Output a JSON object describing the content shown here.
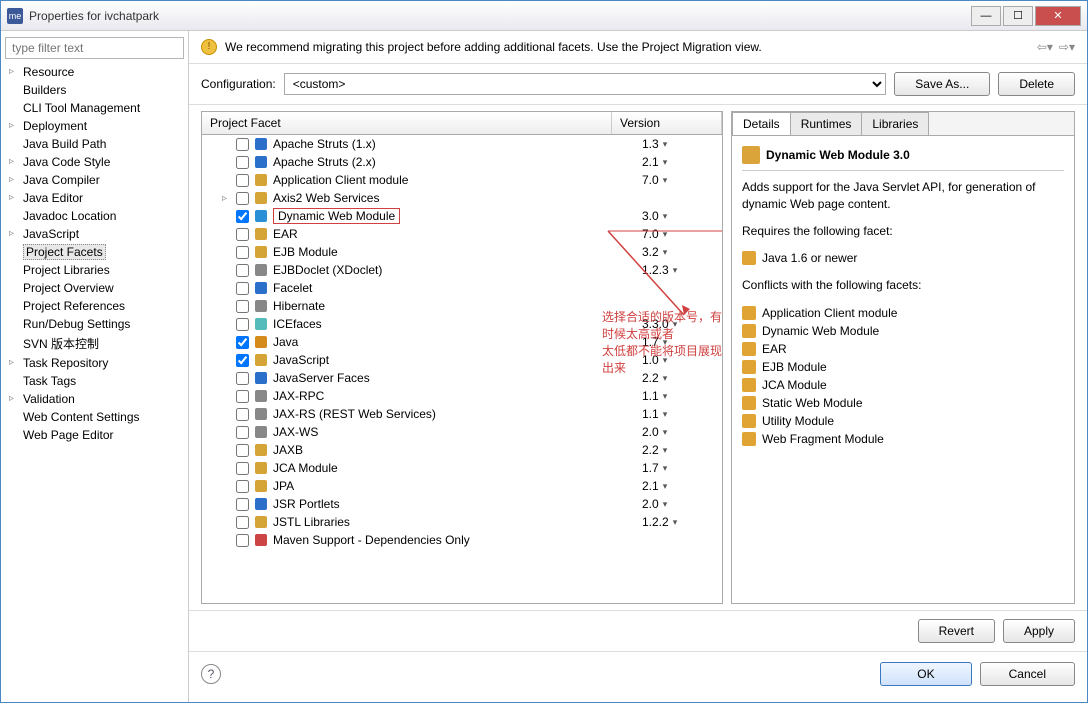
{
  "window": {
    "title": "Properties for ivchatpark"
  },
  "filter": {
    "placeholder": "type filter text"
  },
  "sidebar": {
    "items": [
      {
        "label": "Resource"
      },
      {
        "label": "Builders"
      },
      {
        "label": "CLI Tool Management"
      },
      {
        "label": "Deployment"
      },
      {
        "label": "Java Build Path"
      },
      {
        "label": "Java Code Style"
      },
      {
        "label": "Java Compiler"
      },
      {
        "label": "Java Editor"
      },
      {
        "label": "Javadoc Location"
      },
      {
        "label": "JavaScript"
      },
      {
        "label": "Project Facets",
        "selected": true
      },
      {
        "label": "Project Libraries"
      },
      {
        "label": "Project Overview"
      },
      {
        "label": "Project References"
      },
      {
        "label": "Run/Debug Settings"
      },
      {
        "label": "SVN 版本控制"
      },
      {
        "label": "Task Repository"
      },
      {
        "label": "Task Tags"
      },
      {
        "label": "Validation"
      },
      {
        "label": "Web Content Settings"
      },
      {
        "label": "Web Page Editor"
      }
    ]
  },
  "banner": {
    "text": "We recommend migrating this project before adding additional facets. Use the Project Migration view."
  },
  "config": {
    "label": "Configuration:",
    "value": "<custom>",
    "saveas": "Save As...",
    "delete": "Delete"
  },
  "facet_header": {
    "c1": "Project Facet",
    "c2": "Version"
  },
  "facets": [
    {
      "label": "Apache Struts (1.x)",
      "ver": "1.3",
      "icon": "gear",
      "color": "#2a6fc9"
    },
    {
      "label": "Apache Struts (2.x)",
      "ver": "2.1",
      "icon": "gear",
      "color": "#2a6fc9"
    },
    {
      "label": "Application Client module",
      "ver": "7.0",
      "icon": "box",
      "color": "#d4a437"
    },
    {
      "label": "Axis2 Web Services",
      "ver": "",
      "icon": "folder",
      "expandable": true,
      "color": "#d4a437"
    },
    {
      "label": "Dynamic Web Module",
      "ver": "3.0",
      "checked": true,
      "highlight": true,
      "icon": "globe",
      "color": "#2a8fd4"
    },
    {
      "label": "EAR",
      "ver": "7.0",
      "icon": "box",
      "color": "#d4a437"
    },
    {
      "label": "EJB Module",
      "ver": "3.2",
      "icon": "bean",
      "color": "#d4a437"
    },
    {
      "label": "EJBDoclet (XDoclet)",
      "ver": "1.2.3",
      "icon": "doc",
      "color": "#888"
    },
    {
      "label": "Facelet",
      "ver": "",
      "icon": "f",
      "color": "#2a6fc9"
    },
    {
      "label": "Hibernate",
      "ver": "",
      "icon": "h",
      "color": "#888"
    },
    {
      "label": "ICEfaces",
      "ver": "3.3.0",
      "icon": "ice",
      "color": "#5bb"
    },
    {
      "label": "Java",
      "ver": "1.7",
      "checked": true,
      "icon": "java",
      "color": "#d48b1a"
    },
    {
      "label": "JavaScript",
      "ver": "1.0",
      "checked": true,
      "icon": "js",
      "color": "#d4a437"
    },
    {
      "label": "JavaServer Faces",
      "ver": "2.2",
      "icon": "jsf",
      "color": "#2a6fc9"
    },
    {
      "label": "JAX-RPC",
      "ver": "1.1",
      "icon": "jax",
      "color": "#888"
    },
    {
      "label": "JAX-RS (REST Web Services)",
      "ver": "1.1",
      "icon": "jax",
      "color": "#888"
    },
    {
      "label": "JAX-WS",
      "ver": "2.0",
      "icon": "jax",
      "color": "#888"
    },
    {
      "label": "JAXB",
      "ver": "2.2",
      "icon": "jax",
      "color": "#d4a437"
    },
    {
      "label": "JCA Module",
      "ver": "1.7",
      "icon": "jca",
      "color": "#d4a437"
    },
    {
      "label": "JPA",
      "ver": "2.1",
      "icon": "jpa",
      "color": "#d4a437"
    },
    {
      "label": "JSR Portlets",
      "ver": "2.0",
      "icon": "p",
      "color": "#2a6fc9"
    },
    {
      "label": "JSTL Libraries",
      "ver": "1.2.2",
      "icon": "lib",
      "color": "#d4a437"
    },
    {
      "label": "Maven Support - Dependencies Only",
      "ver": "",
      "icon": "m",
      "color": "#c44"
    }
  ],
  "tabs": {
    "t1": "Details",
    "t2": "Runtimes",
    "t3": "Libraries"
  },
  "detail": {
    "title": "Dynamic Web Module 3.0",
    "desc": "Adds support for the Java Servlet API, for generation of dynamic Web page content.",
    "req_label": "Requires the following facet:",
    "req": "Java 1.6 or newer",
    "con_label": "Conflicts with the following facets:",
    "conflicts": [
      "Application Client module",
      "Dynamic Web Module",
      "EAR",
      "EJB Module",
      "JCA Module",
      "Static Web Module",
      "Utility Module",
      "Web Fragment Module"
    ]
  },
  "annotation": {
    "line1": "选择合适的版本号，有时候太高或者",
    "line2": "太低都不能将项目展现出来"
  },
  "buttons": {
    "revert": "Revert",
    "apply": "Apply",
    "ok": "OK",
    "cancel": "Cancel"
  }
}
